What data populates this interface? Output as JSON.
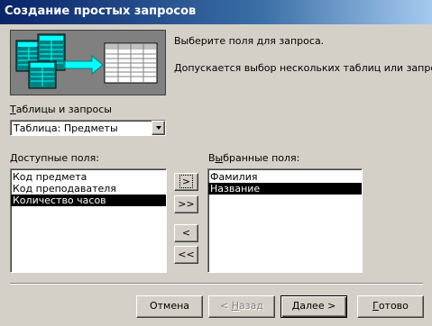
{
  "window": {
    "title": "Создание простых запросов"
  },
  "description": {
    "line1": "Выберите поля для запроса.",
    "line2": "Допускается выбор нескольких таблиц или запросов."
  },
  "tables": {
    "label_mnemonic": "Т",
    "label_rest": "аблицы и запросы",
    "selected": "Таблица: Предметы"
  },
  "available": {
    "label_mnemonic": "Д",
    "label_rest": "оступные поля:",
    "items": [
      "Код предмета",
      "Код преподавателя",
      "Количество часов"
    ],
    "selected_index": 2
  },
  "chosen": {
    "label_pre": "В",
    "label_mnemonic": "ы",
    "label_rest": "бранные поля:",
    "items": [
      "Фамилия",
      "Название"
    ],
    "selected_index": 1
  },
  "transfer": {
    "add_one": ">",
    "add_all": ">>",
    "remove_one": "<",
    "remove_all": "<<"
  },
  "buttons": {
    "cancel": "Отмена",
    "back_pre": "< ",
    "back_mnemonic": "Н",
    "back_rest": "азад",
    "next_mnemonic": "Д",
    "next_rest": "алее >",
    "finish_mnemonic": "Г",
    "finish_rest": "отово"
  },
  "colors": {
    "selection": "#000000",
    "title_start": "#0a246a",
    "title_end": "#a6caf0"
  }
}
